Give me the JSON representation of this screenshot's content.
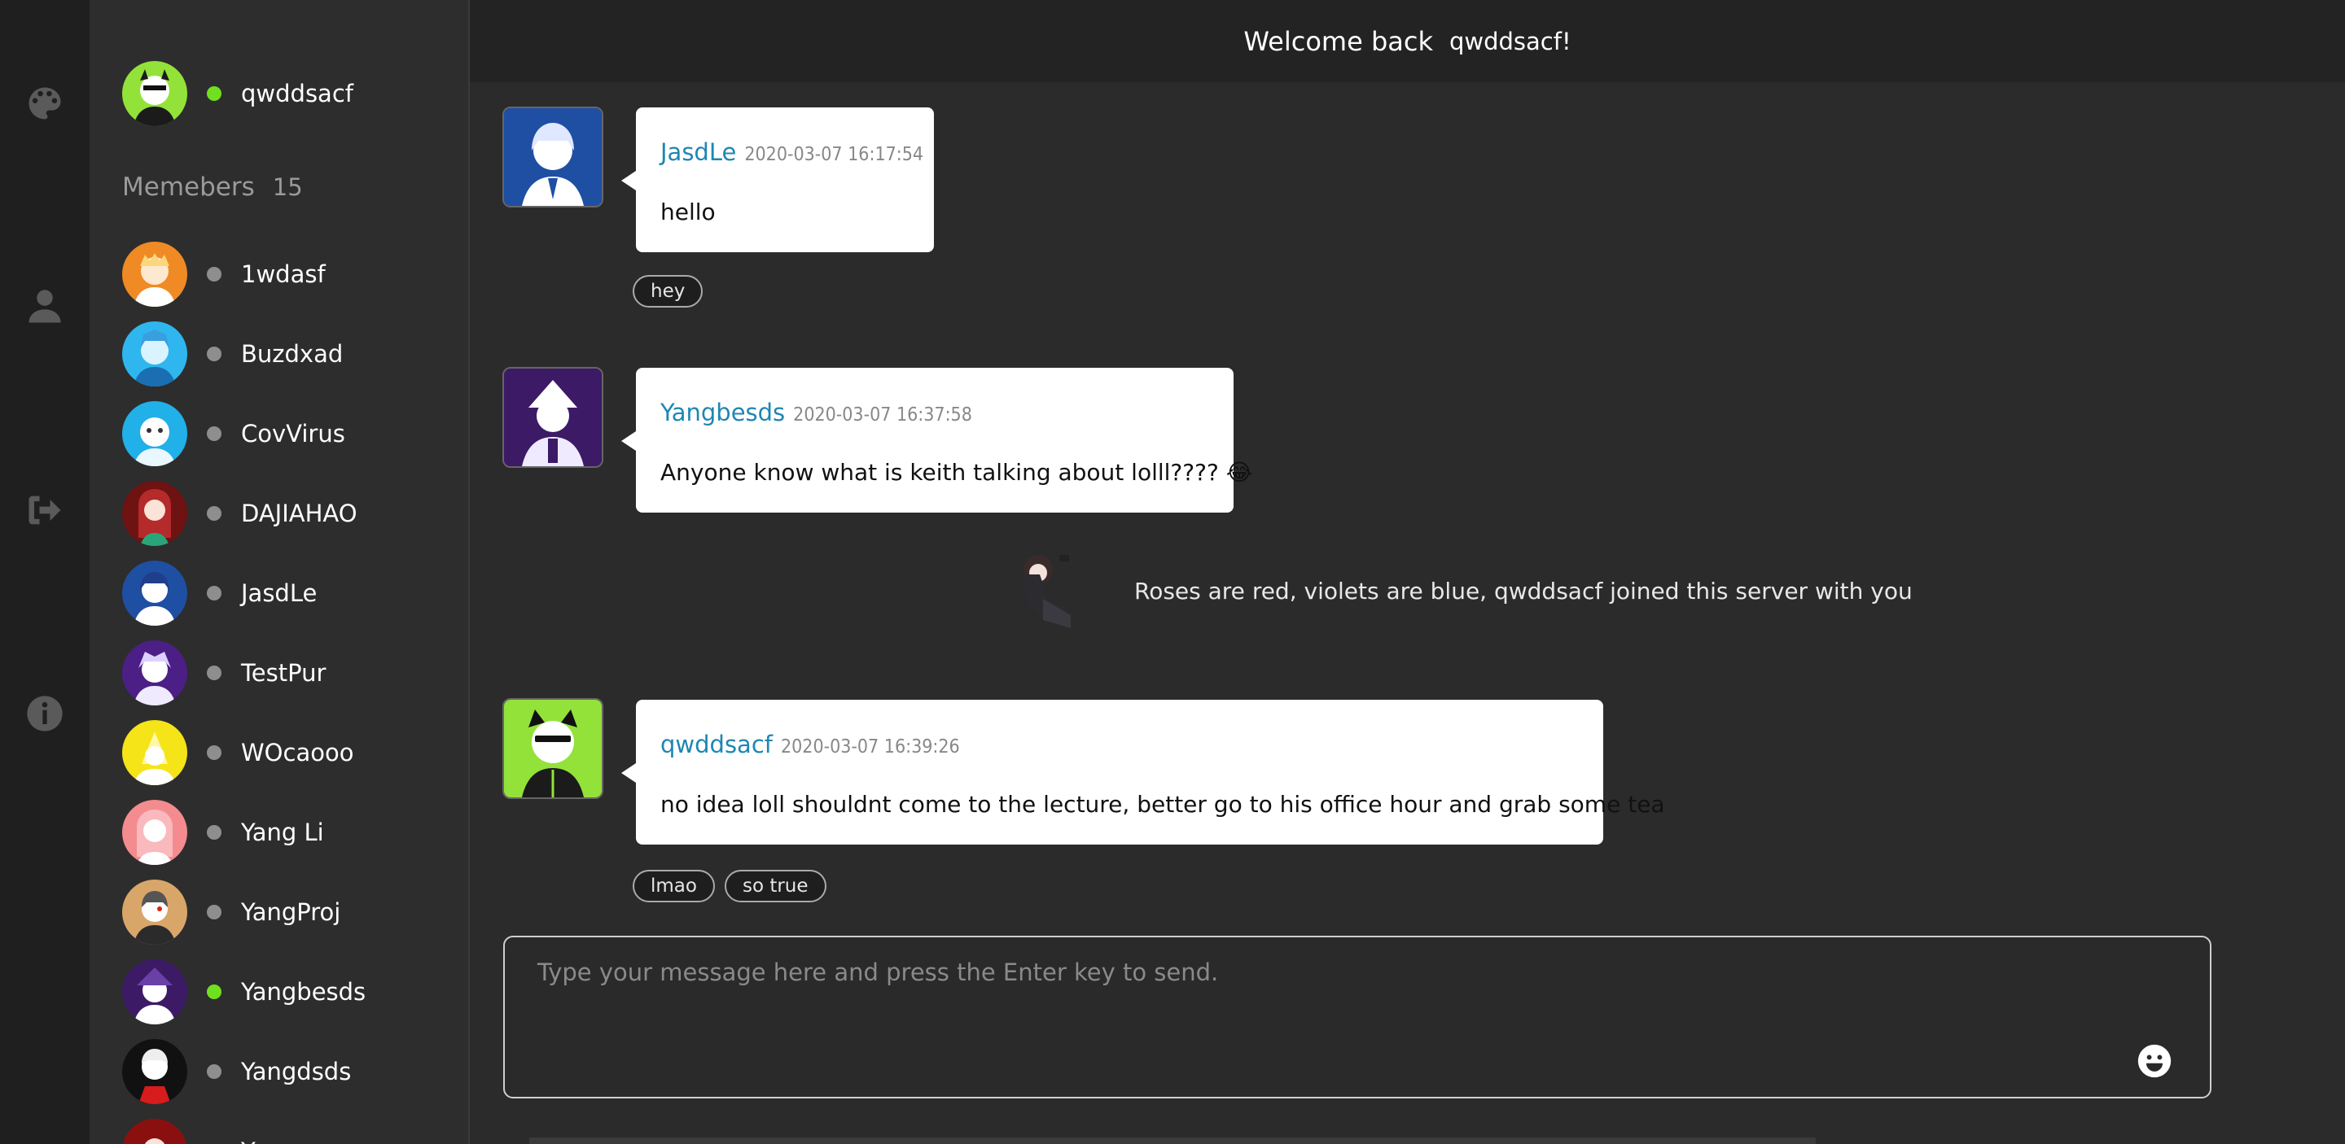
{
  "header": {
    "welcome": "Welcome back",
    "username": "qwddsacf!"
  },
  "current_user": {
    "name": "qwddsacf",
    "status_color": "#6fe01f"
  },
  "members": {
    "label": "Memebers",
    "count": "15",
    "items": [
      {
        "name": "1wdasf",
        "status_color": "#8e8e8e"
      },
      {
        "name": "Buzdxad",
        "status_color": "#8e8e8e"
      },
      {
        "name": "CovVirus",
        "status_color": "#8e8e8e"
      },
      {
        "name": "DAJIAHAO",
        "status_color": "#8e8e8e"
      },
      {
        "name": "JasdLe",
        "status_color": "#8e8e8e"
      },
      {
        "name": "TestPur",
        "status_color": "#8e8e8e"
      },
      {
        "name": "WOcaooo",
        "status_color": "#8e8e8e"
      },
      {
        "name": "Yang Li",
        "status_color": "#8e8e8e"
      },
      {
        "name": "YangProj",
        "status_color": "#8e8e8e"
      },
      {
        "name": "Yangbesds",
        "status_color": "#6fe01f"
      },
      {
        "name": "Yangdsds",
        "status_color": "#8e8e8e"
      },
      {
        "name": "Y...",
        "status_color": "#8e8e8e"
      }
    ]
  },
  "messages": [
    {
      "user": "JasdLe",
      "time": "2020-03-07 16:17:54",
      "text": "hello",
      "reactions": [
        "hey"
      ]
    },
    {
      "user": "Yangbesds",
      "time": "2020-03-07 16:37:58",
      "text": "Anyone know what is keith talking about lolll???? 😂",
      "reactions": []
    },
    {
      "user": "qwddsacf",
      "time": "2020-03-07 16:39:26",
      "text": "no idea loll shouldnt come to the lecture, better go to his office hour and grab some tea",
      "reactions": [
        "lmao",
        "so true"
      ]
    }
  ],
  "system_message": "Roses are red, violets are blue, qwddsacf joined this server with you",
  "composer": {
    "placeholder": "Type your message here and press the Enter key to send."
  },
  "icons": [
    "palette-icon",
    "user-icon",
    "sign-out-icon",
    "info-icon",
    "smile-icon"
  ],
  "colors": {
    "accent_username": "#1f86b3",
    "online": "#6fe01f",
    "offline": "#8e8e8e"
  }
}
